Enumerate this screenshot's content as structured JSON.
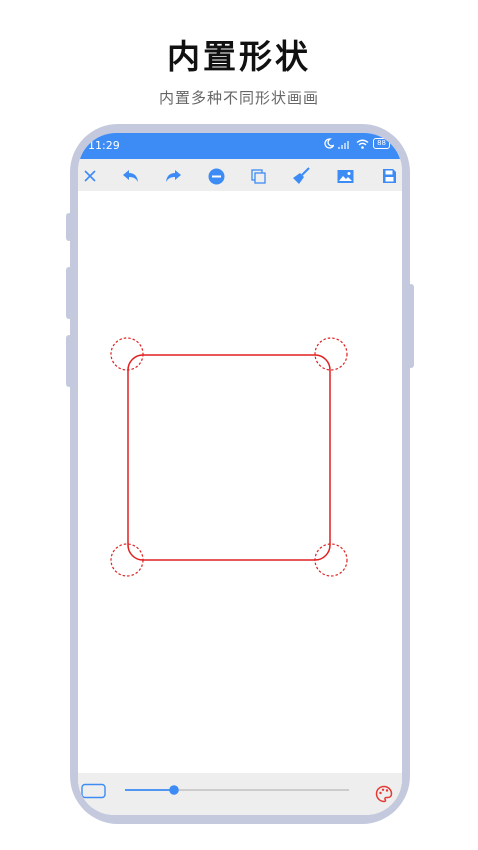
{
  "header": {
    "title": "内置形状",
    "subtitle": "内置多种不同形状画画"
  },
  "status_bar": {
    "time": "11:29",
    "battery": "88",
    "color": "#3d8bf5"
  },
  "toolbar": {
    "icons": [
      "close-icon",
      "undo-icon",
      "redo-icon",
      "eraser-icon",
      "copy-icon",
      "clear-broom-icon",
      "image-icon",
      "save-icon"
    ],
    "icon_color": "#3d8bf5"
  },
  "canvas": {
    "shape": "rounded-rectangle",
    "stroke_color": "#e02020"
  },
  "bottom_bar": {
    "stroke_width_slider": 0.22,
    "palette_color": "#e53935"
  }
}
